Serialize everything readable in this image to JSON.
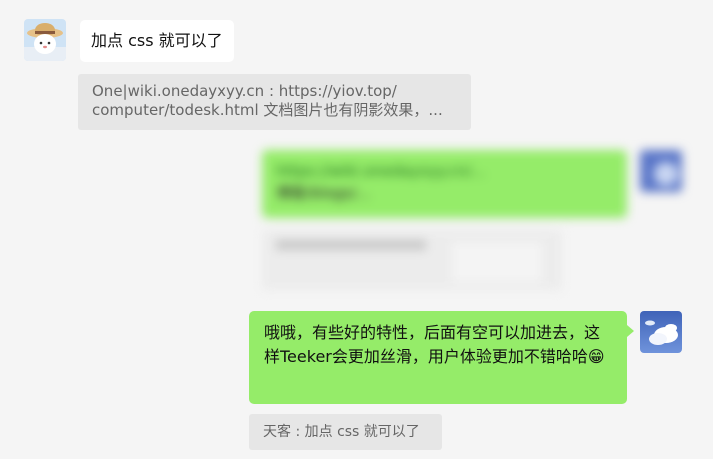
{
  "messages": {
    "m1": {
      "text": "加点 css 就可以了",
      "avatar_icon": "straw-hat-cartoon-avatar-icon"
    },
    "quote1": {
      "line1": "One|wiki.onedayxyy.cn :    https://yiov.top/",
      "line2": "computer/todesk.html     文档图片也有阴影效果，..."
    },
    "m2_blurred": {
      "line1": "https://wiki.onedayxyy.cn/...",
      "line2": "博客/blogs/...",
      "avatar_icon": "blurred-blue-avatar-icon"
    },
    "m3": {
      "text": "哦哦，有些好的特性，后面有空可以加进去，这样Teeker会更加丝滑，用户体验更加不错哈哈😁",
      "avatar_icon": "sky-clouds-avatar-icon"
    },
    "quote2": {
      "text": "天客 : 加点 css 就可以了"
    }
  },
  "colors": {
    "background": "#f5f5f5",
    "bubble_white": "#ffffff",
    "bubble_green": "#95ec69",
    "quote_bg": "#e6e6e6",
    "quote_text": "#666666"
  }
}
